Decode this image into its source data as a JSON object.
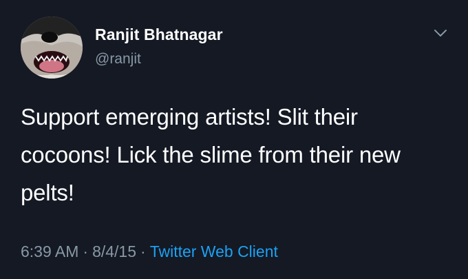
{
  "user": {
    "display_name": "Ranjit Bhatnagar",
    "handle": "@ranjit"
  },
  "tweet": {
    "text": "Support emerging artists! Slit their cocoons! Lick the slime from their new pelts!",
    "time": "6:39 AM",
    "date": "8/4/15",
    "separator": "·",
    "client": "Twitter Web Client"
  },
  "icons": {
    "menu": "chevron-down-icon",
    "avatar": "dog-avatar"
  },
  "colors": {
    "background": "#141924",
    "secondary_text": "#8899a6",
    "link": "#1da1f2"
  }
}
